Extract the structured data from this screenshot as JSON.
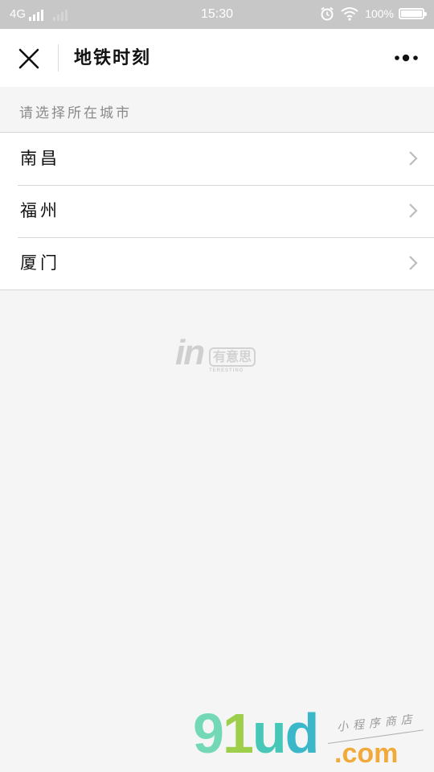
{
  "status_bar": {
    "network": "4G",
    "time": "15:30",
    "battery": "100%",
    "battery_level": 1.0,
    "icons": [
      "signal-icon",
      "signal-weak-icon",
      "alarm-icon",
      "wifi-icon",
      "battery-icon"
    ]
  },
  "nav": {
    "title": "地铁时刻",
    "close_icon": "close-icon",
    "more_icon": "more-dots-icon"
  },
  "section": {
    "header": "请选择所在城市"
  },
  "cities": [
    {
      "name": "南昌"
    },
    {
      "name": "福州"
    },
    {
      "name": "厦门"
    }
  ],
  "logo": {
    "mark": "in",
    "cn": "有意思",
    "sub": "TERESTING"
  },
  "watermark": {
    "g": "9",
    "one": "1",
    "u": "u",
    "d": "d",
    "com": ".com",
    "sub": "小程序商店"
  },
  "colors": {
    "status_bar_bg": "#c7c7c7",
    "background": "#f5f5f5",
    "text_primary": "#111111",
    "text_secondary": "#8a8a8a"
  }
}
